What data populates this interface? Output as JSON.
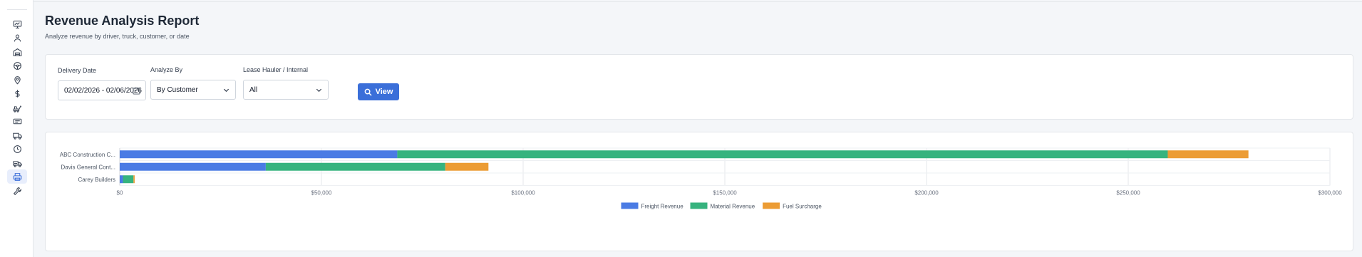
{
  "page": {
    "title": "Revenue Analysis Report",
    "subtitle": "Analyze revenue by driver, truck, customer, or date"
  },
  "sidebar": {
    "items": [
      {
        "icon": "dashboard-chart-icon"
      },
      {
        "icon": "users-icon"
      },
      {
        "icon": "warehouse-icon"
      },
      {
        "icon": "steering-wheel-icon"
      },
      {
        "icon": "map-pin-icon"
      },
      {
        "icon": "dollar-icon"
      },
      {
        "icon": "loader-icon"
      },
      {
        "icon": "ticket-icon"
      },
      {
        "icon": "truck-icon"
      },
      {
        "icon": "clock-icon"
      },
      {
        "icon": "dump-truck-icon"
      },
      {
        "icon": "printer-icon",
        "active": true
      },
      {
        "icon": "wrench-icon"
      }
    ]
  },
  "filters": {
    "delivery_date_label": "Delivery Date",
    "delivery_date_value": "02/02/2026 - 02/06/2026",
    "analyze_by_label": "Analyze By",
    "analyze_by_value": "By Customer",
    "lease_hauler_label": "Lease Hauler / Internal",
    "lease_hauler_value": "All",
    "view_label": "View"
  },
  "colors": {
    "accent": "#3b6fd9",
    "freight": "#4a7be4",
    "material": "#36b37e",
    "fuel": "#ec9c34"
  },
  "chart_data": {
    "type": "bar",
    "orientation": "horizontal",
    "stacked": true,
    "categories": [
      "ABC Construction C...",
      "Davis General Cont...",
      "Carey Builders"
    ],
    "series": [
      {
        "name": "Freight Revenue",
        "values": [
          68800,
          36200,
          800
        ]
      },
      {
        "name": "Material Revenue",
        "values": [
          191000,
          44500,
          2600
        ]
      },
      {
        "name": "Fuel Surcharge",
        "values": [
          20000,
          10700,
          300
        ]
      }
    ],
    "xlim": [
      0,
      300000
    ],
    "xticks": [
      "$0",
      "$50,000",
      "$100,000",
      "$150,000",
      "$200,000",
      "$250,000",
      "$300,000"
    ],
    "grid": true,
    "legend": "bottom"
  }
}
